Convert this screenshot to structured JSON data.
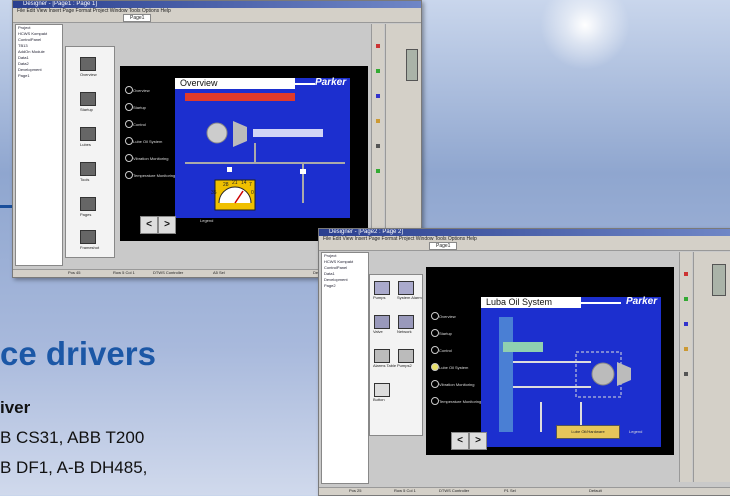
{
  "colors": {
    "accent": "#1b57a6",
    "hmi_blue": "#1c2fcf",
    "title_bar": "#2a3f8f"
  },
  "slide": {
    "heading": "ce drivers",
    "subheading": "iver",
    "lines": [
      "B CS31, ABB T200",
      "B DF1, A-B DH485,"
    ]
  },
  "window1": {
    "title": "Designer - [Page1 : Page 1]",
    "menu": "File  Edit  View  Insert  Page  Format  Project  Window  Tools  Options  Help",
    "page_combo": "Page1",
    "tree": [
      "Project",
      "HCWS Kompakt",
      "ControlPanel",
      "TB13",
      "AddOn Module",
      "Data1",
      "Data2",
      "Development",
      "Page1"
    ],
    "palette": [
      "Overview",
      "Startup",
      "Lubes",
      "Tools",
      "Pages",
      "Frameshot"
    ],
    "hmi_title": "Overview",
    "brand": "Parker",
    "menu_items": [
      "Overview",
      "Startup",
      "Control",
      "Lube Oil System",
      "Vibration Monitoring",
      "Temperature Monitoring"
    ],
    "gauge_labels": [
      "28",
      "21",
      "14",
      "7",
      "35",
      "0"
    ],
    "legend": "Legend",
    "status": [
      "Pos 45",
      "Row 5 Col 1",
      "DTWS Controller",
      "A5 Sel",
      "Default"
    ]
  },
  "window2": {
    "title": "Designer - [Page2 : Page 2]",
    "menu": "File  Edit  View  Insert  Page  Format  Project  Window  Tools  Options  Help",
    "page_combo": "Page1",
    "tree": [
      "Project",
      "HCWS Kompakt",
      "ControlPanel",
      "Data1",
      "Development",
      "Page2"
    ],
    "palette": [
      "Pumps",
      "System Alarm",
      "Valve",
      "Network",
      "Alarms Table",
      "Pumps2",
      "Button"
    ],
    "hmi_title": "Luba Oil System",
    "brand": "Parker",
    "menu_items": [
      "Overview",
      "Startup",
      "Control",
      "Lube Oil System",
      "Vibration Monitoring",
      "Temperature Monitoring"
    ],
    "button": "Lube Oil/Hardware",
    "legend": "Legend",
    "status": [
      "Pos 25",
      "Row 5 Col 1",
      "DTWS Controller",
      "P1 Sel",
      "Default"
    ]
  }
}
